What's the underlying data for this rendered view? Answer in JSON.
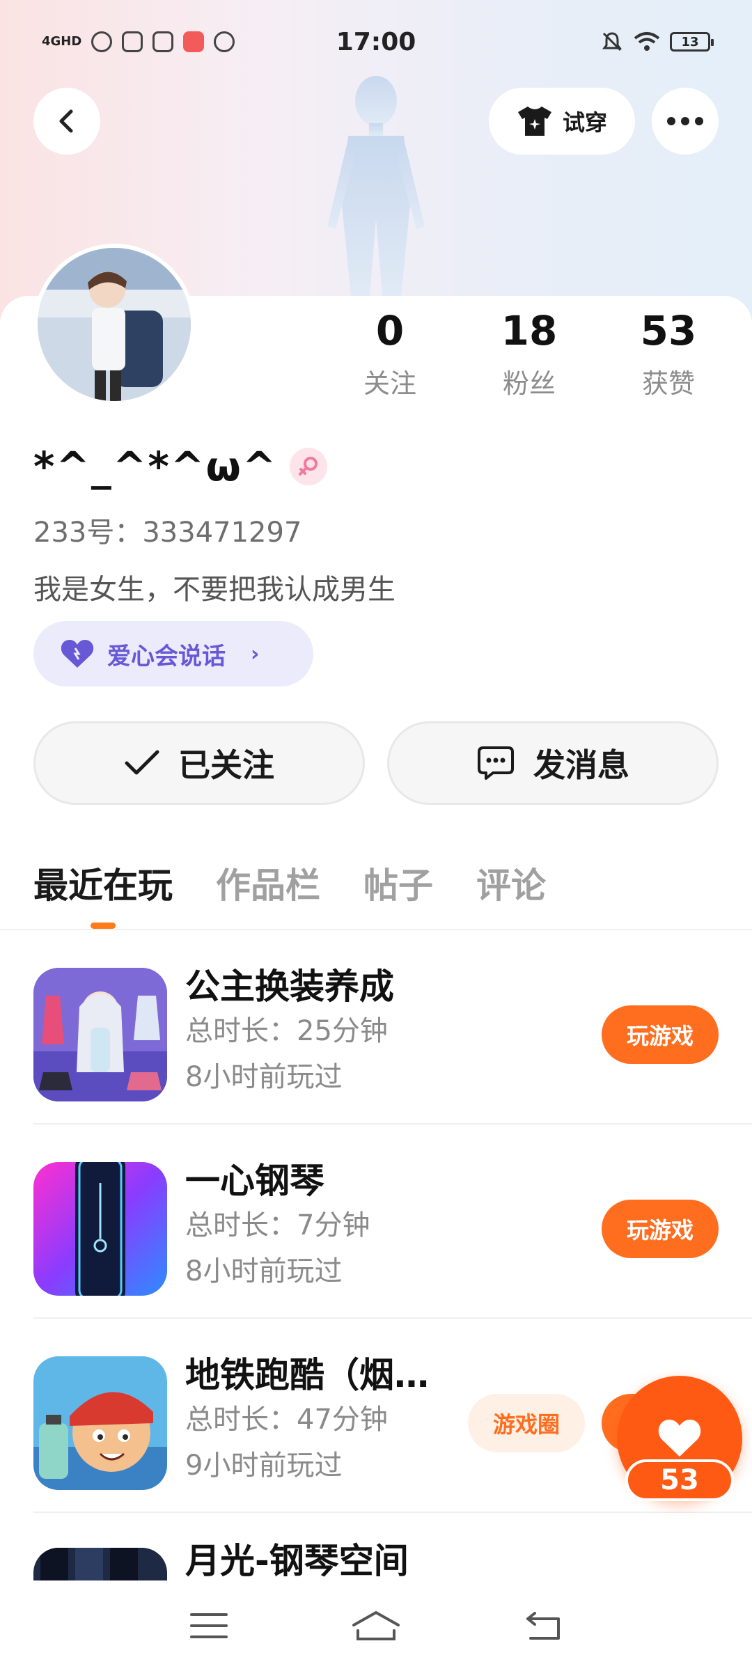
{
  "status_bar": {
    "network": "4GHD",
    "time": "17:00",
    "battery": "13"
  },
  "header": {
    "tryon_label": "试穿"
  },
  "profile": {
    "nickname": "*^_^*^ω^",
    "uid": "233号：333471297",
    "bio": "我是女生，不要把我认成男生",
    "love_badge": "爱心会说话",
    "stats": [
      {
        "value": "0",
        "label": "关注"
      },
      {
        "value": "18",
        "label": "粉丝"
      },
      {
        "value": "53",
        "label": "获赞"
      }
    ],
    "follow_label": "已关注",
    "message_label": "发消息"
  },
  "tabs": [
    "最近在玩",
    "作品栏",
    "帖子",
    "评论"
  ],
  "games": [
    {
      "title": "公主换装养成",
      "duration": "总时长：25分钟",
      "last_played": "8小时前玩过",
      "action": "玩游戏"
    },
    {
      "title": "一心钢琴",
      "duration": "总时长：7分钟",
      "last_played": "8小时前玩过",
      "action": "玩游戏"
    },
    {
      "title": "地铁跑酷（烟…",
      "duration": "总时长：47分钟",
      "last_played": "9小时前玩过",
      "circle": "游戏圈"
    },
    {
      "title": "月光-钢琴空间"
    }
  ],
  "like_float": {
    "count": "53"
  },
  "colors": {
    "accent": "#ff6d1f",
    "love_badge_text": "#6758d6",
    "love_badge_bg": "#ecebfc"
  }
}
